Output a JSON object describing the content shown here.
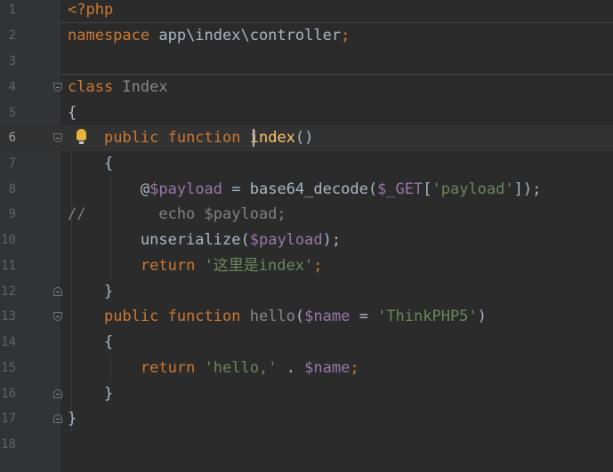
{
  "line_numbers": [
    "1",
    "2",
    "3",
    "4",
    "5",
    "6",
    "7",
    "8",
    "9",
    "10",
    "11",
    "12",
    "13",
    "14",
    "15",
    "16",
    "17",
    "18"
  ],
  "code": {
    "l1": {
      "open_tag": "<?php"
    },
    "l2": {
      "kw": "namespace",
      "ns": " app\\index\\controller",
      "semi": ";"
    },
    "l4": {
      "kw": "class",
      "name": " Index"
    },
    "l5": {
      "brace": "{"
    },
    "l6": {
      "indent": "    ",
      "kw": "public function",
      "name": " index",
      "parens": "()"
    },
    "l7": {
      "indent": "    ",
      "brace": "{"
    },
    "l8": {
      "indent": "        ",
      "at": "@",
      "var": "$payload",
      "eq": " = ",
      "fn": "base64_decode",
      "open": "(",
      "get": "$_GET",
      "lb": "[",
      "key": "'payload'",
      "close": "]);"
    },
    "l9": {
      "comment": "//        echo $payload;"
    },
    "l10": {
      "indent": "        ",
      "fn": "unserialize",
      "open": "(",
      "var": "$payload",
      "close": ");"
    },
    "l11": {
      "indent": "        ",
      "kw": "return",
      "sp": " ",
      "str": "'这里是index'",
      "semi": ";"
    },
    "l12": {
      "indent": "    ",
      "brace": "}"
    },
    "l13": {
      "indent": "    ",
      "kw": "public function",
      "name": " hello",
      "open": "(",
      "var": "$name",
      "eq": " = ",
      "str": "'ThinkPHP5'",
      "close": ")"
    },
    "l14": {
      "indent": "    ",
      "brace": "{"
    },
    "l15": {
      "indent": "        ",
      "kw": "return",
      "sp": " ",
      "str": "'hello,'",
      "dot": " . ",
      "var": "$name",
      "semi": ";"
    },
    "l16": {
      "indent": "    ",
      "brace": "}"
    },
    "l17": {
      "brace": "}"
    }
  },
  "theme": {
    "background": "#2b2b2b",
    "gutter": "#313335",
    "keyword": "#cc7832",
    "variable": "#9876aa",
    "string": "#6a8759",
    "function_name": "#ffc66d",
    "text": "#a9b7c6",
    "current_line": "#323232"
  },
  "icons": {
    "intention_bulb": "lightbulb-icon",
    "fold_markers": "fold-icon"
  }
}
